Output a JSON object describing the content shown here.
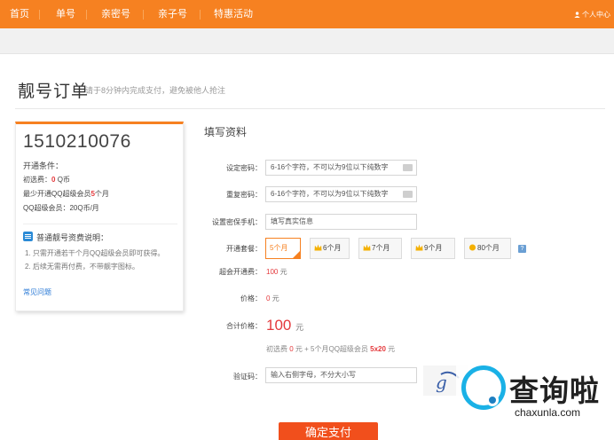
{
  "topnav": {
    "items": [
      "首页",
      "单号",
      "亲密号",
      "亲子号",
      "特惠活动"
    ],
    "account": "个人中心"
  },
  "page": {
    "title": "靓号订单",
    "subtitle": "请于8分钟内完成支付，避免被他人抢注"
  },
  "card": {
    "number": "1510210076",
    "cond_title": "开通条件：",
    "fee_label": "初选费：",
    "fee_value": "0",
    "fee_unit": "Q币",
    "min_prefix": "最少开通QQ超级会员",
    "min_value": "5",
    "min_suffix": "个月",
    "member_price": "QQ超级会员：20Q币/月",
    "help_title": "普通靓号资费说明：",
    "help_lines": [
      "1. 只需开通若干个月QQ超级会员即可获得。",
      "2. 后续无需再付费，不带靓字图标。"
    ],
    "faq": "常见问题"
  },
  "form": {
    "title": "填写资料",
    "password_label": "设定密码：",
    "password_placeholder": "6-16个字符，不可以为9位以下纯数字",
    "confirm_label": "重复密码：",
    "confirm_placeholder": "6-16个字符，不可以为9位以下纯数字",
    "phone_label": "设置密保手机：",
    "phone_placeholder": "填写真实信息",
    "package_label": "开通套餐：",
    "packages": [
      "5个月",
      "6个月",
      "7个月",
      "9个月",
      "80个月"
    ],
    "selected_package": "5个月",
    "fee_label": "超会开通费：",
    "fee_value": "100",
    "fee_unit": "元",
    "price_label": "价格：",
    "price_value": "0",
    "price_unit": "元",
    "total_label": "合计价格：",
    "total_value": "100",
    "total_unit": "元",
    "breakdown_a": "初选费 ",
    "breakdown_b": "0",
    "breakdown_c": " 元 + 5个月QQ超级会员 ",
    "breakdown_d": "5x20",
    "breakdown_e": " 元",
    "captcha_label": "验证码：",
    "captcha_placeholder": "输入右侧字母，不分大小写",
    "submit": "确定支付"
  },
  "watermark": {
    "brand": "查询啦",
    "domain": "chaxunla.com"
  },
  "colors": {
    "nav": "#f68121",
    "accent_red": "#e4393c",
    "submit": "#f14f1c"
  }
}
